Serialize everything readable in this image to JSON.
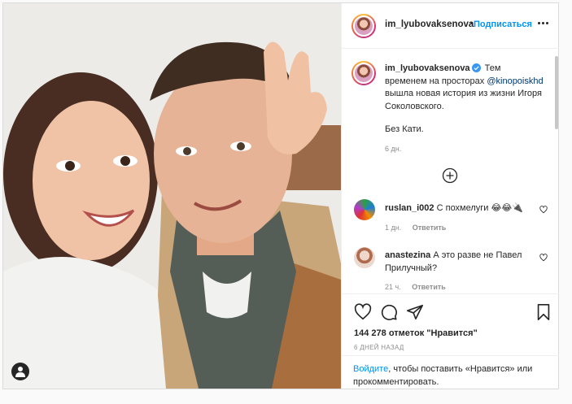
{
  "post": {
    "author": "im_lyubovaksenova",
    "follow_label": "Подписаться",
    "caption": {
      "author": "im_lyubovaksenova",
      "text_before_mention": "Тем временем на просторах",
      "mention": "@kinopoiskhd",
      "text_after_mention": "вышла новая история из жизни Игоря Соколовского.",
      "extra_line": "Без Кати.",
      "time": "6 дн."
    },
    "comments": [
      {
        "author": "ruslan_i002",
        "text": "С похмелуги 😂😂🔌",
        "time": "1 дн.",
        "reply_label": "Ответить"
      },
      {
        "author": "anastezina",
        "text": "А это разве не Павел Прилучный?",
        "time": "21 ч.",
        "reply_label": "Ответить"
      }
    ],
    "likes_text": "144 278 отметок \"Нравится\"",
    "date_text": "6 дней назад"
  },
  "login_prompt": {
    "link": "Войдите",
    "text": ", чтобы поставить «Нравится» или прокомментировать."
  },
  "icons": {
    "more": "more-horizontal-icon",
    "verified": "verified-badge-icon",
    "load_more": "plus-circle-icon",
    "like": "heart-icon",
    "comment": "comment-bubble-icon",
    "share": "paper-plane-icon",
    "save": "bookmark-icon",
    "tagged_user": "user-tag-icon"
  },
  "colors": {
    "accent": "#0095f6",
    "link": "#00376b",
    "text": "#262626",
    "muted": "#8e8e8e",
    "border": "#dbdbdb"
  }
}
